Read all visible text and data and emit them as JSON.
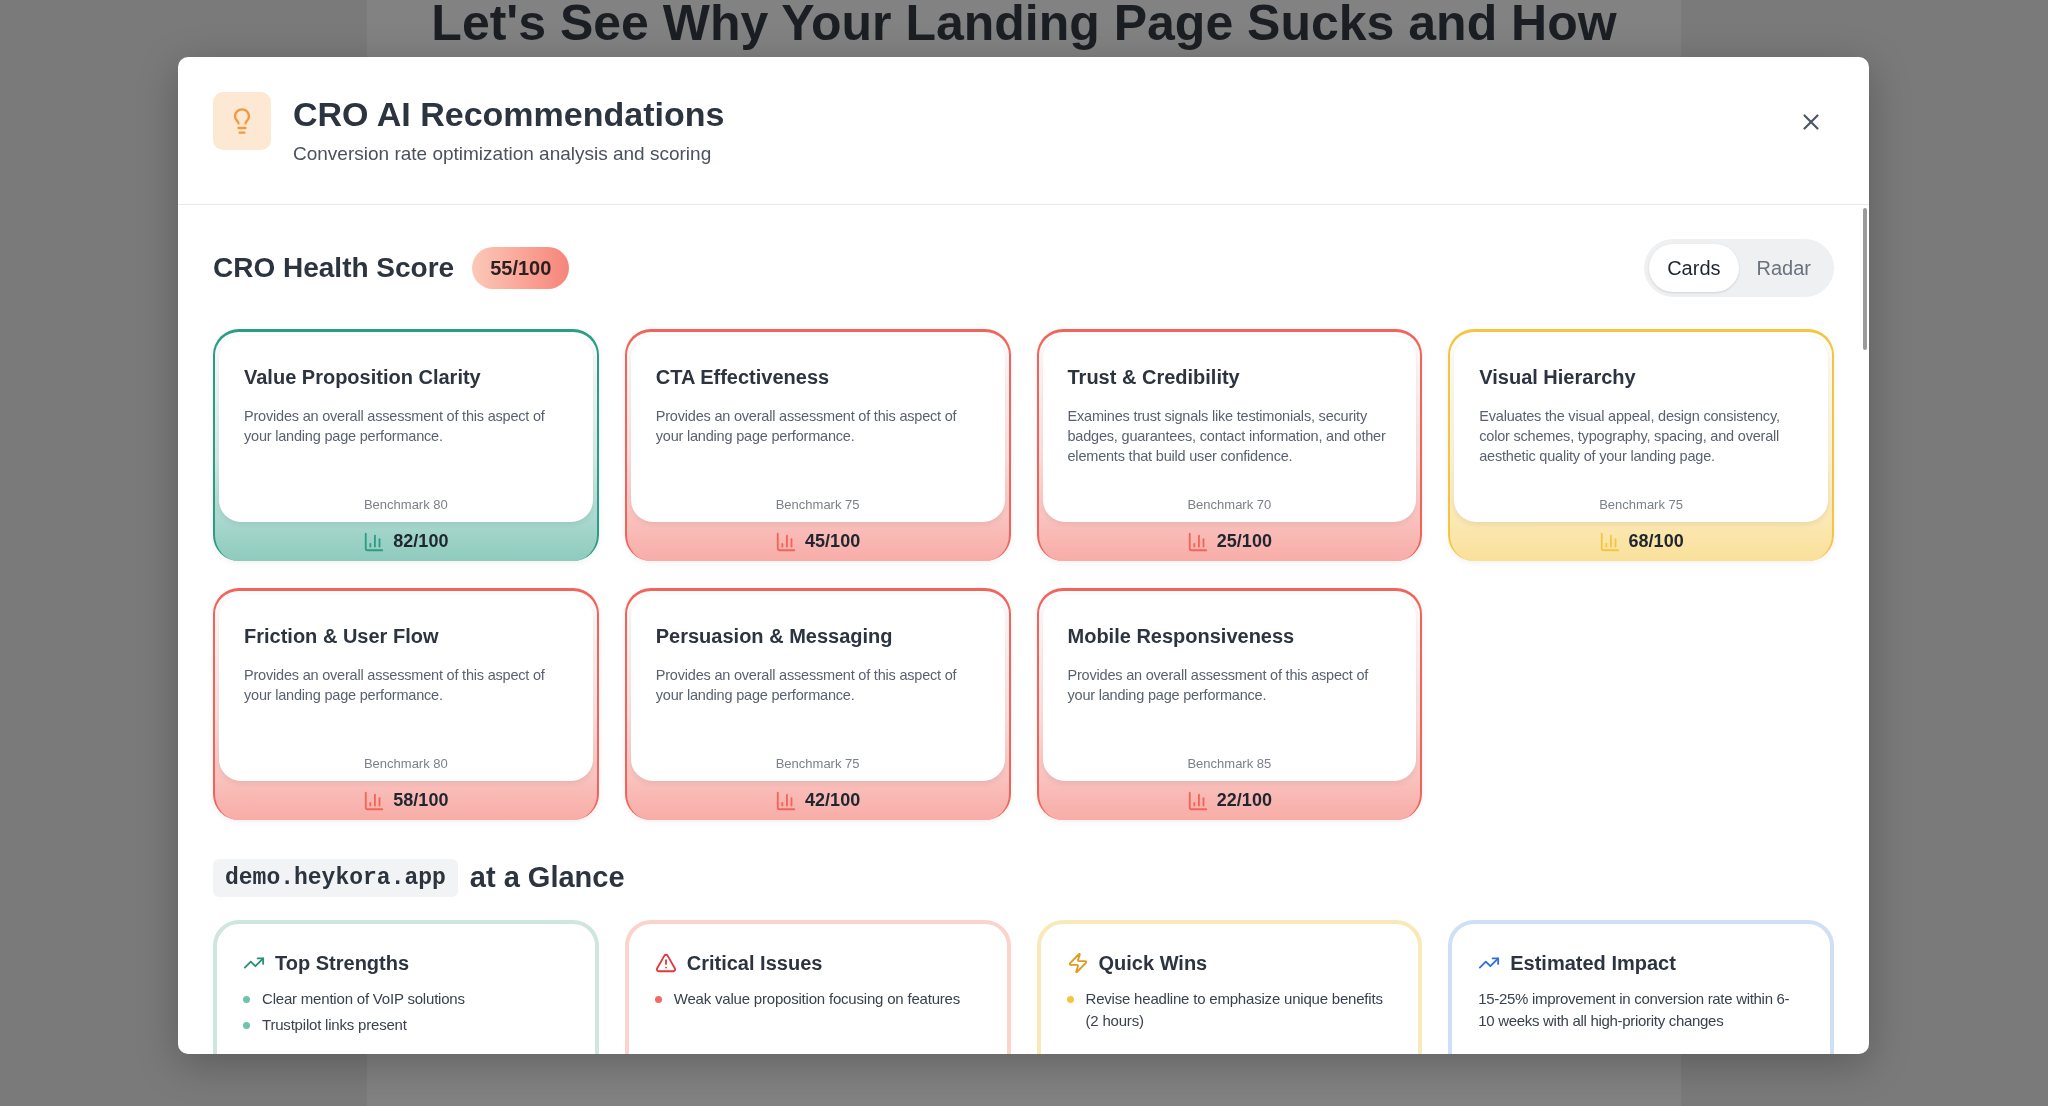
{
  "background_page": {
    "heading": "Let's See Why Your Landing Page Sucks and How"
  },
  "modal": {
    "title": "CRO AI Recommendations",
    "subtitle": "Conversion rate optimization analysis and scoring"
  },
  "health": {
    "title": "CRO Health Score",
    "score": "55/100",
    "view_toggle": [
      {
        "label": "Cards",
        "selected": true
      },
      {
        "label": "Radar",
        "selected": false
      }
    ],
    "cards": [
      {
        "title": "Value Proposition Clarity",
        "description": "Provides an overall assessment of this aspect of your landing page performance.",
        "benchmark": "Benchmark 80",
        "score": "82/100",
        "color": "#2a9d84"
      },
      {
        "title": "CTA Effectiveness",
        "description": "Provides an overall assessment of this aspect of your landing page performance.",
        "benchmark": "Benchmark 75",
        "score": "45/100",
        "color": "#f2645a"
      },
      {
        "title": "Trust & Credibility",
        "description": "Examines trust signals like testimonials, security badges, guarantees, contact information, and other elements that build user confidence.",
        "benchmark": "Benchmark 70",
        "score": "25/100",
        "color": "#f2645a"
      },
      {
        "title": "Visual Hierarchy",
        "description": "Evaluates the visual appeal, design consistency, color schemes, typography, spacing, and overall aesthetic quality of your landing page.",
        "benchmark": "Benchmark 75",
        "score": "68/100",
        "color": "#f5c542"
      },
      {
        "title": "Friction & User Flow",
        "description": "Provides an overall assessment of this aspect of your landing page performance.",
        "benchmark": "Benchmark 80",
        "score": "58/100",
        "color": "#f2645a"
      },
      {
        "title": "Persuasion & Messaging",
        "description": "Provides an overall assessment of this aspect of your landing page performance.",
        "benchmark": "Benchmark 75",
        "score": "42/100",
        "color": "#f2645a"
      },
      {
        "title": "Mobile Responsiveness",
        "description": "Provides an overall assessment of this aspect of your landing page performance.",
        "benchmark": "Benchmark 85",
        "score": "22/100",
        "color": "#f2645a"
      }
    ]
  },
  "glance": {
    "domain": "demo.heykora.app",
    "title": "at a Glance",
    "cards": [
      {
        "kind": "strengths",
        "title": "Top Strengths",
        "items": [
          "Clear mention of VoIP solutions",
          "Trustpilot links present"
        ]
      },
      {
        "kind": "issues",
        "title": "Critical Issues",
        "items": [
          "Weak value proposition focusing on features"
        ]
      },
      {
        "kind": "wins",
        "title": "Quick Wins",
        "items": [
          "Revise headline to emphasize unique benefits (2 hours)"
        ]
      },
      {
        "kind": "impact",
        "title": "Estimated Impact",
        "text": "15-25% improvement in conversion rate within 6-10 weeks with all high-priority changes"
      }
    ]
  }
}
